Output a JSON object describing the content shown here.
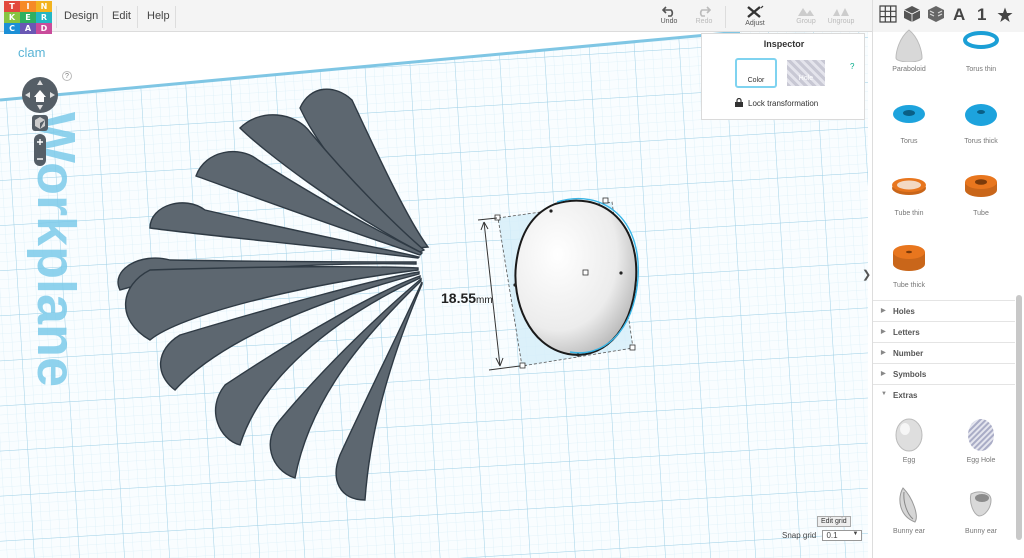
{
  "logo": {
    "letters": [
      "T",
      "I",
      "N",
      "K",
      "E",
      "R",
      "C",
      "A",
      "D"
    ],
    "colors": [
      "#e2483d",
      "#f68a26",
      "#f2b31f",
      "#86c440",
      "#2eaf61",
      "#23b6c4",
      "#1b8fd6",
      "#6a58b4",
      "#c94c9b"
    ]
  },
  "menu": {
    "design": "Design",
    "edit": "Edit",
    "help": "Help"
  },
  "toolbar": {
    "undo": "Undo",
    "redo": "Redo",
    "adjust": "Adjust",
    "group": "Group",
    "ungroup": "Ungroup"
  },
  "view_tools": [
    "grid-view-icon",
    "cube-icon",
    "textured-cube-icon",
    "letter-a-icon",
    "number-1-icon",
    "star-icon"
  ],
  "view_labels": {
    "letter": "A",
    "number": "1"
  },
  "document": {
    "title": "clam"
  },
  "workplane": {
    "label": "Workplane"
  },
  "dimension": {
    "value": "18.55",
    "unit": "mm"
  },
  "nav": {
    "help": "?"
  },
  "inspector": {
    "title": "Inspector",
    "color_label": "Color",
    "hole_label": "Hole",
    "lock_label": "Lock transformation",
    "help": "?"
  },
  "grid": {
    "edit_label": "Edit grid",
    "snap_label": "Snap grid",
    "snap_value": "0.1"
  },
  "shapes": [
    {
      "label": "Paraboloid",
      "icon": "paraboloid-icon"
    },
    {
      "label": "Torus thin",
      "icon": "torus-thin-icon"
    },
    {
      "label": "Torus",
      "icon": "torus-icon"
    },
    {
      "label": "Torus thick",
      "icon": "torus-thick-icon"
    },
    {
      "label": "Tube thin",
      "icon": "tube-thin-icon"
    },
    {
      "label": "Tube",
      "icon": "tube-icon"
    },
    {
      "label": "Tube thick",
      "icon": "tube-thick-icon"
    }
  ],
  "categories": [
    {
      "label": "Holes",
      "expanded": false
    },
    {
      "label": "Letters",
      "expanded": false
    },
    {
      "label": "Number",
      "expanded": false
    },
    {
      "label": "Symbols",
      "expanded": false
    },
    {
      "label": "Extras",
      "expanded": true
    }
  ],
  "extras": [
    {
      "label": "Egg",
      "icon": "egg-icon"
    },
    {
      "label": "Egg Hole",
      "icon": "egg-hole-icon"
    },
    {
      "label": "Bunny ear",
      "icon": "bunny-ear-icon"
    },
    {
      "label": "Bunny ear",
      "icon": "bunny-ear-icon"
    }
  ],
  "colors": {
    "accent": "#7fd3f0",
    "shape_gray": "#5d6770",
    "orange": "#e8761e",
    "blue": "#1da3dd",
    "grid": "#cfe9f5"
  }
}
